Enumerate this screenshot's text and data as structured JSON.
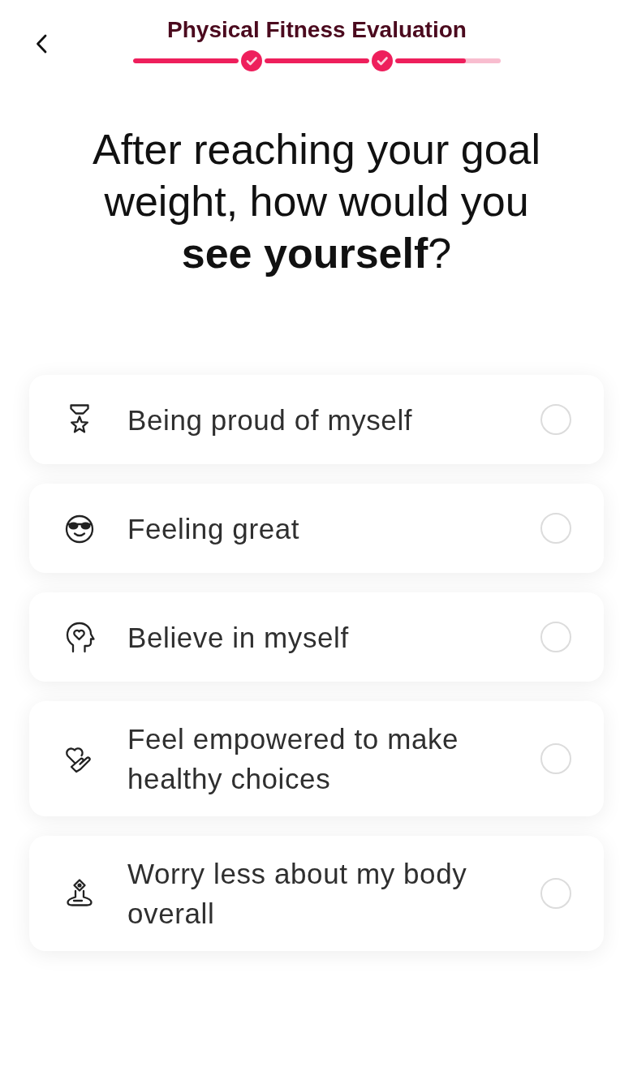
{
  "header": {
    "title": "Physical Fitness Evaluation"
  },
  "progress": {
    "segments": [
      {
        "level": 1
      },
      {
        "level": 1
      },
      {
        "level": 0.67
      }
    ],
    "checkpoints": [
      {
        "done": true
      },
      {
        "done": true
      }
    ]
  },
  "question": "After reaching your goal weight, how would you **see yourself**?",
  "options": [
    {
      "label": "Being proud of myself",
      "selected": false
    },
    {
      "label": "Feeling great",
      "selected": false
    },
    {
      "label": "Believe in myself",
      "selected": false
    },
    {
      "label": "Feel empowered to make healthy choices",
      "selected": false
    },
    {
      "label": "Worry less about my body overall",
      "selected": false
    }
  ]
}
